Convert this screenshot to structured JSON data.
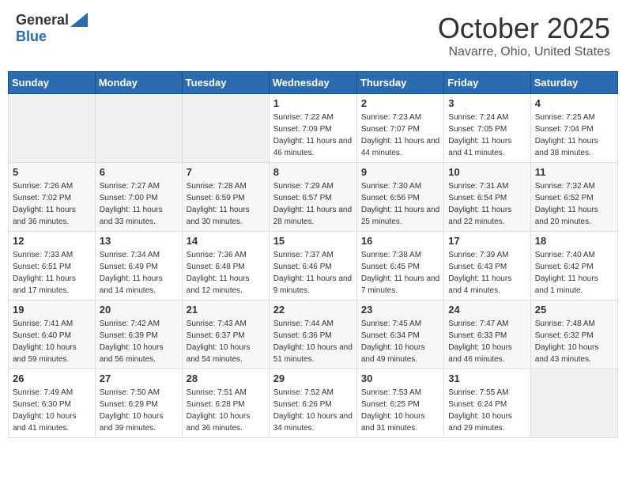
{
  "header": {
    "logo_line1": "General",
    "logo_line2": "Blue",
    "month_title": "October 2025",
    "location": "Navarre, Ohio, United States"
  },
  "days_of_week": [
    "Sunday",
    "Monday",
    "Tuesday",
    "Wednesday",
    "Thursday",
    "Friday",
    "Saturday"
  ],
  "weeks": [
    [
      {
        "day": "",
        "sunrise": "",
        "sunset": "",
        "daylight": ""
      },
      {
        "day": "",
        "sunrise": "",
        "sunset": "",
        "daylight": ""
      },
      {
        "day": "",
        "sunrise": "",
        "sunset": "",
        "daylight": ""
      },
      {
        "day": "1",
        "sunrise": "Sunrise: 7:22 AM",
        "sunset": "Sunset: 7:09 PM",
        "daylight": "Daylight: 11 hours and 46 minutes."
      },
      {
        "day": "2",
        "sunrise": "Sunrise: 7:23 AM",
        "sunset": "Sunset: 7:07 PM",
        "daylight": "Daylight: 11 hours and 44 minutes."
      },
      {
        "day": "3",
        "sunrise": "Sunrise: 7:24 AM",
        "sunset": "Sunset: 7:05 PM",
        "daylight": "Daylight: 11 hours and 41 minutes."
      },
      {
        "day": "4",
        "sunrise": "Sunrise: 7:25 AM",
        "sunset": "Sunset: 7:04 PM",
        "daylight": "Daylight: 11 hours and 38 minutes."
      }
    ],
    [
      {
        "day": "5",
        "sunrise": "Sunrise: 7:26 AM",
        "sunset": "Sunset: 7:02 PM",
        "daylight": "Daylight: 11 hours and 36 minutes."
      },
      {
        "day": "6",
        "sunrise": "Sunrise: 7:27 AM",
        "sunset": "Sunset: 7:00 PM",
        "daylight": "Daylight: 11 hours and 33 minutes."
      },
      {
        "day": "7",
        "sunrise": "Sunrise: 7:28 AM",
        "sunset": "Sunset: 6:59 PM",
        "daylight": "Daylight: 11 hours and 30 minutes."
      },
      {
        "day": "8",
        "sunrise": "Sunrise: 7:29 AM",
        "sunset": "Sunset: 6:57 PM",
        "daylight": "Daylight: 11 hours and 28 minutes."
      },
      {
        "day": "9",
        "sunrise": "Sunrise: 7:30 AM",
        "sunset": "Sunset: 6:56 PM",
        "daylight": "Daylight: 11 hours and 25 minutes."
      },
      {
        "day": "10",
        "sunrise": "Sunrise: 7:31 AM",
        "sunset": "Sunset: 6:54 PM",
        "daylight": "Daylight: 11 hours and 22 minutes."
      },
      {
        "day": "11",
        "sunrise": "Sunrise: 7:32 AM",
        "sunset": "Sunset: 6:52 PM",
        "daylight": "Daylight: 11 hours and 20 minutes."
      }
    ],
    [
      {
        "day": "12",
        "sunrise": "Sunrise: 7:33 AM",
        "sunset": "Sunset: 6:51 PM",
        "daylight": "Daylight: 11 hours and 17 minutes."
      },
      {
        "day": "13",
        "sunrise": "Sunrise: 7:34 AM",
        "sunset": "Sunset: 6:49 PM",
        "daylight": "Daylight: 11 hours and 14 minutes."
      },
      {
        "day": "14",
        "sunrise": "Sunrise: 7:36 AM",
        "sunset": "Sunset: 6:48 PM",
        "daylight": "Daylight: 11 hours and 12 minutes."
      },
      {
        "day": "15",
        "sunrise": "Sunrise: 7:37 AM",
        "sunset": "Sunset: 6:46 PM",
        "daylight": "Daylight: 11 hours and 9 minutes."
      },
      {
        "day": "16",
        "sunrise": "Sunrise: 7:38 AM",
        "sunset": "Sunset: 6:45 PM",
        "daylight": "Daylight: 11 hours and 7 minutes."
      },
      {
        "day": "17",
        "sunrise": "Sunrise: 7:39 AM",
        "sunset": "Sunset: 6:43 PM",
        "daylight": "Daylight: 11 hours and 4 minutes."
      },
      {
        "day": "18",
        "sunrise": "Sunrise: 7:40 AM",
        "sunset": "Sunset: 6:42 PM",
        "daylight": "Daylight: 11 hours and 1 minute."
      }
    ],
    [
      {
        "day": "19",
        "sunrise": "Sunrise: 7:41 AM",
        "sunset": "Sunset: 6:40 PM",
        "daylight": "Daylight: 10 hours and 59 minutes."
      },
      {
        "day": "20",
        "sunrise": "Sunrise: 7:42 AM",
        "sunset": "Sunset: 6:39 PM",
        "daylight": "Daylight: 10 hours and 56 minutes."
      },
      {
        "day": "21",
        "sunrise": "Sunrise: 7:43 AM",
        "sunset": "Sunset: 6:37 PM",
        "daylight": "Daylight: 10 hours and 54 minutes."
      },
      {
        "day": "22",
        "sunrise": "Sunrise: 7:44 AM",
        "sunset": "Sunset: 6:36 PM",
        "daylight": "Daylight: 10 hours and 51 minutes."
      },
      {
        "day": "23",
        "sunrise": "Sunrise: 7:45 AM",
        "sunset": "Sunset: 6:34 PM",
        "daylight": "Daylight: 10 hours and 49 minutes."
      },
      {
        "day": "24",
        "sunrise": "Sunrise: 7:47 AM",
        "sunset": "Sunset: 6:33 PM",
        "daylight": "Daylight: 10 hours and 46 minutes."
      },
      {
        "day": "25",
        "sunrise": "Sunrise: 7:48 AM",
        "sunset": "Sunset: 6:32 PM",
        "daylight": "Daylight: 10 hours and 43 minutes."
      }
    ],
    [
      {
        "day": "26",
        "sunrise": "Sunrise: 7:49 AM",
        "sunset": "Sunset: 6:30 PM",
        "daylight": "Daylight: 10 hours and 41 minutes."
      },
      {
        "day": "27",
        "sunrise": "Sunrise: 7:50 AM",
        "sunset": "Sunset: 6:29 PM",
        "daylight": "Daylight: 10 hours and 39 minutes."
      },
      {
        "day": "28",
        "sunrise": "Sunrise: 7:51 AM",
        "sunset": "Sunset: 6:28 PM",
        "daylight": "Daylight: 10 hours and 36 minutes."
      },
      {
        "day": "29",
        "sunrise": "Sunrise: 7:52 AM",
        "sunset": "Sunset: 6:26 PM",
        "daylight": "Daylight: 10 hours and 34 minutes."
      },
      {
        "day": "30",
        "sunrise": "Sunrise: 7:53 AM",
        "sunset": "Sunset: 6:25 PM",
        "daylight": "Daylight: 10 hours and 31 minutes."
      },
      {
        "day": "31",
        "sunrise": "Sunrise: 7:55 AM",
        "sunset": "Sunset: 6:24 PM",
        "daylight": "Daylight: 10 hours and 29 minutes."
      },
      {
        "day": "",
        "sunrise": "",
        "sunset": "",
        "daylight": ""
      }
    ]
  ]
}
